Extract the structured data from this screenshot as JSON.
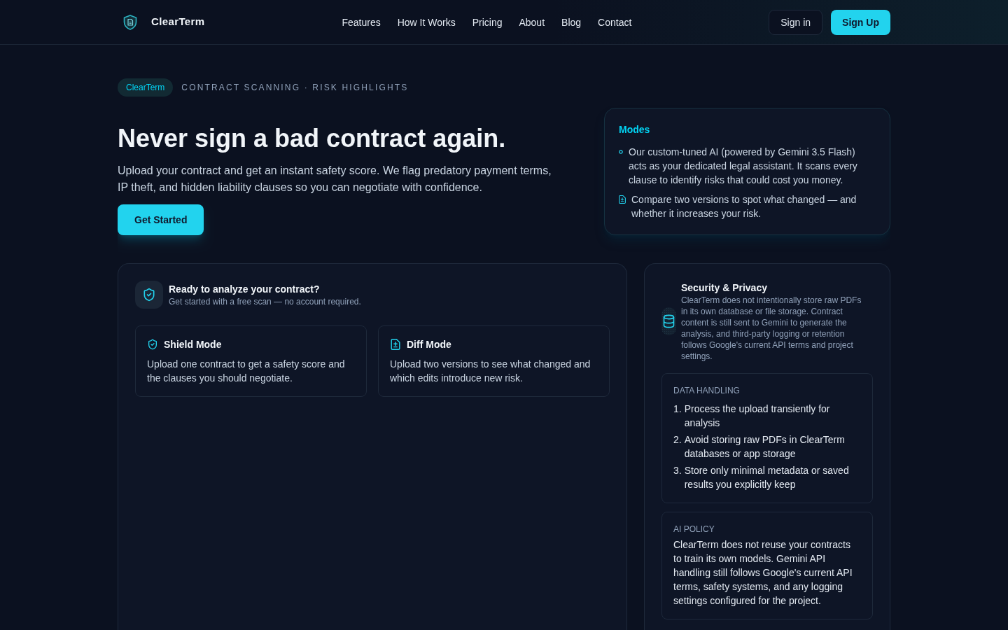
{
  "nav": {
    "brand": "ClearTerm",
    "links": [
      "Features",
      "How It Works",
      "Pricing",
      "About",
      "Blog",
      "Contact"
    ],
    "sign_in": "Sign in",
    "sign_up": "Sign Up"
  },
  "hero": {
    "badge": "ClearTerm",
    "eyebrow": "CONTRACT SCANNING · RISK HIGHLIGHTS",
    "title": "Never sign a bad contract again.",
    "description": "Upload your contract and get an instant safety score. We flag predatory payment terms, IP theft, and hidden liability clauses so you can negotiate with confidence.",
    "cta": "Get Started"
  },
  "modes_panel": {
    "title": "Modes",
    "items": [
      {
        "kind": "shield",
        "text": "Our custom-tuned AI (powered by Gemini 3.5 Flash) acts as your dedicated legal assistant. It scans every clause to identify risks that could cost you money."
      },
      {
        "kind": "diff",
        "text": "Compare two versions to spot what changed — and whether it increases your risk."
      }
    ]
  },
  "analyze_panel": {
    "title": "Ready to analyze your contract?",
    "subtitle": "Get started with a free scan — no account required.",
    "modes": [
      {
        "kind": "shield",
        "title": "Shield Mode",
        "description": "Upload one contract to get a safety score and the clauses you should negotiate."
      },
      {
        "kind": "diff",
        "title": "Diff Mode",
        "description": "Upload two versions to see what changed and which edits introduce new risk."
      }
    ]
  },
  "security_panel": {
    "title": "Security & Privacy",
    "description": "ClearTerm does not intentionally store raw PDFs in its own database or file storage. Contract content is still sent to Gemini to generate the analysis, and third-party logging or retention follows Google's current API terms and project settings.",
    "sections": [
      {
        "kind": "list",
        "heading": "DATA HANDLING",
        "items": [
          {
            "marker": "1.",
            "text": "Process the upload transiently for analysis"
          },
          {
            "marker": "2.",
            "text": "Avoid storing raw PDFs in ClearTerm databases or app storage"
          },
          {
            "marker": "3.",
            "text": "Store only minimal metadata or saved results you explicitly keep"
          }
        ]
      },
      {
        "kind": "text",
        "heading": "AI POLICY",
        "text": "ClearTerm does not reuse your contracts to train its own models. Gemini API handling still follows Google's current API terms, safety systems, and any logging settings configured for the project."
      }
    ]
  }
}
